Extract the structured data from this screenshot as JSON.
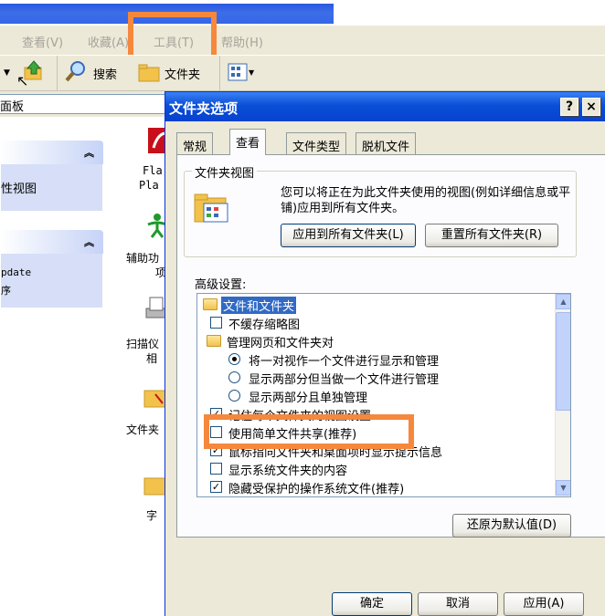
{
  "menubar": {
    "items": [
      {
        "label": "查看(V)"
      },
      {
        "label": "收藏(A)"
      },
      {
        "label": "工具(T)"
      },
      {
        "label": "帮助(H)"
      }
    ]
  },
  "toolbar": {
    "search_label": "搜索",
    "folders_label": "文件夹"
  },
  "address": {
    "value": "面板"
  },
  "left_pane": {
    "panel1_item": "性视图",
    "panel2_line1": "pdate",
    "panel2_line2": "序"
  },
  "desktop_items": [
    {
      "label": "Fla"
    },
    {
      "label": "Pla"
    },
    {
      "label": "辅助功"
    },
    {
      "label": "项"
    },
    {
      "label": "扫描仪"
    },
    {
      "label": "相"
    },
    {
      "label": "文件夹"
    },
    {
      "label": "字"
    }
  ],
  "dialog": {
    "title": "文件夹选项",
    "help_btn": "?",
    "close_btn": "×",
    "tabs": [
      {
        "label": "常规"
      },
      {
        "label": "查看"
      },
      {
        "label": "文件类型"
      },
      {
        "label": "脱机文件"
      }
    ],
    "folder_view_group": {
      "label": "文件夹视图",
      "description": "您可以将正在为此文件夹使用的视图(例如详细信息或平铺)应用到所有文件夹。",
      "apply_all_btn": "应用到所有文件夹(L)",
      "reset_all_btn": "重置所有文件夹(R)"
    },
    "advanced_label": "高级设置:",
    "tree": [
      {
        "type": "folder",
        "label": "文件和文件夹",
        "selected": true
      },
      {
        "type": "checkbox",
        "label": "不缓存缩略图",
        "checked": false
      },
      {
        "type": "folder",
        "label": "管理网页和文件夹对"
      },
      {
        "type": "radio",
        "label": "将一对视作一个文件进行显示和管理",
        "checked": true
      },
      {
        "type": "radio",
        "label": "显示两部分但当做一个文件进行管理",
        "checked": false
      },
      {
        "type": "radio",
        "label": "显示两部分且单独管理",
        "checked": false
      },
      {
        "type": "checkbox",
        "label": "记住每个文件夹的视图设置",
        "checked": true
      },
      {
        "type": "checkbox",
        "label": "使用简单文件共享(推荐)",
        "checked": false
      },
      {
        "type": "checkbox",
        "label": "鼠标指向文件夹和桌面项时显示提示信息",
        "checked": true
      },
      {
        "type": "checkbox",
        "label": "显示系统文件夹的内容",
        "checked": false
      },
      {
        "type": "checkbox",
        "label": "隐藏受保护的操作系统文件(推荐)",
        "checked": true
      }
    ],
    "restore_defaults_btn": "还原为默认值(D)",
    "ok_btn": "确定",
    "cancel_btn": "取消",
    "apply_btn": "应用(A)"
  },
  "colors": {
    "highlight": "#f5883c",
    "titlebar": "#0a4fd6",
    "selection": "#316ac5"
  }
}
